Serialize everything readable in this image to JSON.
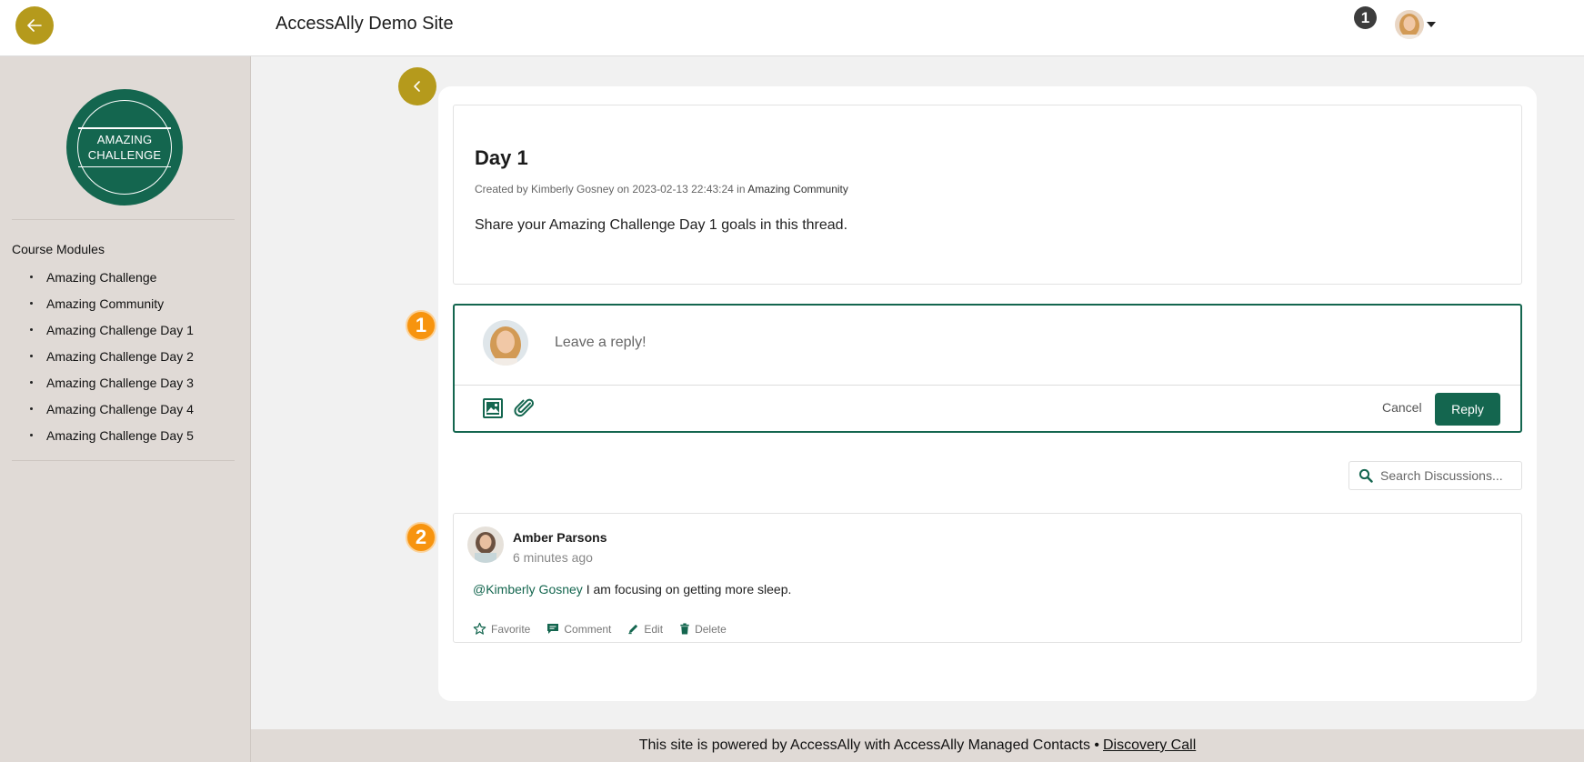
{
  "header": {
    "site_title": "AccessAlly Demo Site",
    "notification_count": "1"
  },
  "sidebar": {
    "logo_line1": "AMAZING",
    "logo_line2": "CHALLENGE",
    "modules_title": "Course Modules",
    "modules": [
      "Amazing Challenge",
      "Amazing Community",
      "Amazing Challenge Day 1",
      "Amazing Challenge Day 2",
      "Amazing Challenge Day 3",
      "Amazing Challenge Day 4",
      "Amazing Challenge Day 5"
    ]
  },
  "post": {
    "title": "Day 1",
    "meta_prefix": "Created by Kimberly Gosney on 2023-02-13 22:43:24 in ",
    "community": "Amazing Community",
    "body": "Share your Amazing Challenge Day 1 goals in this thread."
  },
  "reply": {
    "placeholder": "Leave a reply!",
    "cancel_label": "Cancel",
    "reply_label": "Reply"
  },
  "steps": {
    "one": "1",
    "two": "2"
  },
  "search": {
    "placeholder": "Search Discussions..."
  },
  "comment": {
    "author": "Amber Parsons",
    "time": "6 minutes ago",
    "mention": "@Kimberly Gosney",
    "text": " I am focusing on getting more sleep.",
    "actions": {
      "favorite": "Favorite",
      "comment": "Comment",
      "edit": "Edit",
      "delete": "Delete"
    }
  },
  "footer": {
    "text": "This site is powered by AccessAlly with AccessAlly Managed Contacts •",
    "link": "Discovery Call"
  },
  "colors": {
    "brand_green": "#14664f",
    "gold": "#b59a1c",
    "orange": "#f7940f"
  }
}
